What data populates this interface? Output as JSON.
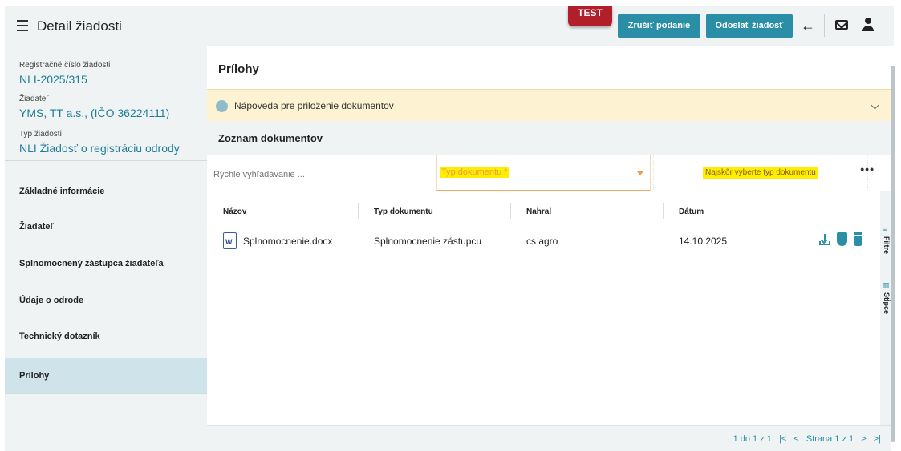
{
  "header": {
    "title": "Detail žiadosti",
    "test_badge": "TEST",
    "cancel_button": "Zrušiť podanie",
    "send_button": "Odoslať žiadosť"
  },
  "sidebar": {
    "info": [
      {
        "label": "Registračné číslo žiadosti",
        "value": "NLI-2025/315"
      },
      {
        "label": "Žiadateľ",
        "value": "YMS, TT a.s., (IČO 36224111)"
      },
      {
        "label": "Typ žiadosti",
        "value": "NLI Žiadosť o registráciu odrody"
      }
    ],
    "nav": [
      {
        "label": "Základné informácie"
      },
      {
        "label": "Žiadateľ"
      },
      {
        "label": "Splnomocnený zástupca žiadateľa"
      },
      {
        "label": "Údaje o odrode"
      },
      {
        "label": "Technický dotazník"
      },
      {
        "label": "Prílohy",
        "active": true
      }
    ]
  },
  "main": {
    "section_title": "Prílohy",
    "help_text": "Nápoveda pre priloženie dokumentov",
    "list_title": "Zoznam dokumentov",
    "search_placeholder": "Rýchle vyhľadávanie ...",
    "type_placeholder": "Typ dokumentu *",
    "type_hint": "Najskôr vyberte typ dokumentu",
    "more": "•••",
    "columns": [
      "Názov",
      "Typ dokumentu",
      "Nahral",
      "Dátum"
    ],
    "rows": [
      {
        "name": "Splnomocnenie.docx",
        "type": "Splnomocnenie zástupcu",
        "uploaded_by": "cs agro",
        "date": "14.10.2025"
      }
    ],
    "tools": [
      "Filtre",
      "Stĺpce"
    ],
    "pager": {
      "range": "1 do 1 z 1",
      "first": "|<",
      "prev": "<",
      "page_text": "Strana 1 z 1",
      "next": ">",
      "last": ">|"
    }
  },
  "colors": {
    "accent": "#2a8fa6",
    "test_badge": "#b01f2a",
    "link_text": "#1f7e97",
    "active_nav": "#cfe4ea",
    "help_banner": "#fdf3d3",
    "highlight": "#ffee00"
  },
  "icons": [
    "menu-icon",
    "back-arrow-icon",
    "mail-icon",
    "user-icon",
    "info-icon",
    "chevron-down-icon",
    "word-doc-icon",
    "download-icon",
    "shield-icon",
    "trash-icon",
    "filter-icon",
    "columns-icon"
  ]
}
